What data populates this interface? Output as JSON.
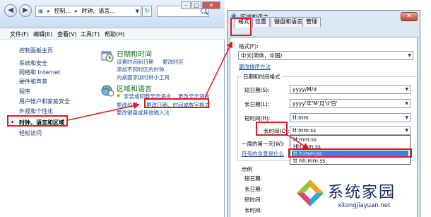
{
  "control_panel": {
    "address_parts": [
      "控制...",
      "时钟、语言..."
    ],
    "menu": [
      "文件(F)",
      "编辑(E)",
      "查看(V)",
      "工具(T)",
      "帮助(H)"
    ],
    "sidebar": [
      "控制面板主页",
      "系统和安全",
      "网络和 Internet",
      "硬件和声音",
      "程序",
      "用户帐户和家庭安全",
      "外观和个性化",
      "时钟、语言和区域",
      "轻松访问"
    ],
    "datetime": {
      "title": "日期和时间",
      "links": [
        "设置时间和日期",
        "更改时区",
        "添加不同时区的时钟",
        "向桌面添加时钟小工具"
      ]
    },
    "region": {
      "title": "区域和语言",
      "links": [
        "安装或卸载显示语言",
        "更改显示语言",
        "更改位置",
        "更改日期、时间或数字格式",
        "更改键盘或其他输入法"
      ]
    }
  },
  "dialog": {
    "title": "区域和语言",
    "tabs": [
      "格式",
      "位置",
      "键盘和语言",
      "管理"
    ],
    "format_label": "格式(F):",
    "format_value": "中文(简体，中国)",
    "sort_link": "更改排序方法",
    "group_title": "日期和时间格式",
    "rows": [
      {
        "label": "短日期(S):",
        "value": "yyyy/M/d"
      },
      {
        "label": "长日期(L):",
        "value": "yyyy'年'M'月'd'日'"
      },
      {
        "label": "短时间(H):",
        "value": "H:mm"
      },
      {
        "label": "长时间(O):",
        "value": "H:mm:ss"
      }
    ],
    "first_day_label": "一周的第一天(W):",
    "notation_link": "符号的含意是什么",
    "long_time_options": [
      "H:mm:ss",
      "HH:mm:ss",
      "tt h:mm:ss",
      "tt hh:mm:ss"
    ],
    "example_title": "示例",
    "example_labels": [
      "短日期:",
      "长日期:",
      "短时间:",
      "长时间:"
    ]
  },
  "watermark": {
    "text": "系统家园",
    "url": "xitongjiayuan.net"
  },
  "colors": {
    "annotation": "#e0181f",
    "link": "#1c4f9c",
    "category_title": "#1a6a1f",
    "selection": "#3c82d6"
  }
}
